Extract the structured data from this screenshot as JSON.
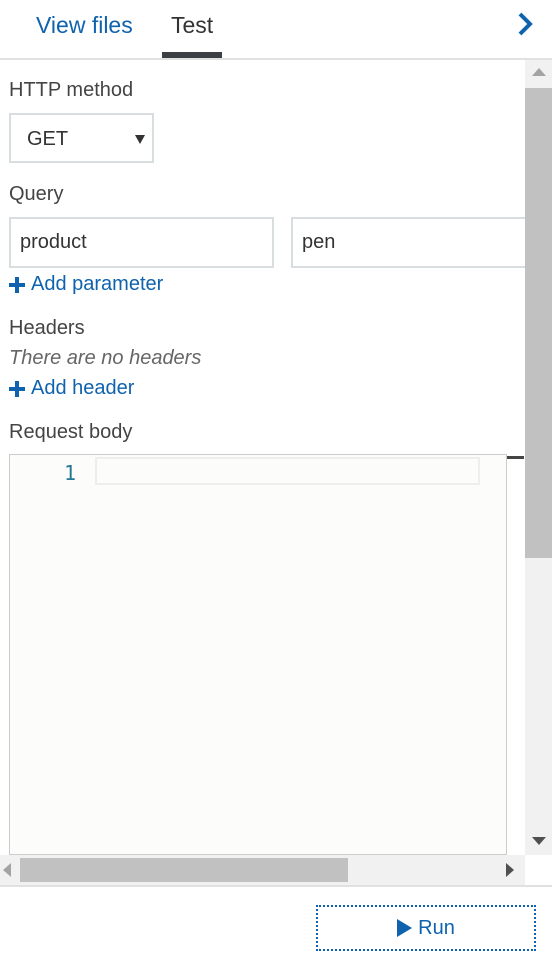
{
  "tabs": [
    {
      "label": "View files"
    },
    {
      "label": "Test"
    }
  ],
  "form": {
    "http_method_label": "HTTP method",
    "http_method_value": "GET",
    "query_label": "Query",
    "query_params": [
      {
        "name": "product",
        "value": "pen"
      }
    ],
    "add_parameter": "Add parameter",
    "headers_label": "Headers",
    "headers_empty": "There are no headers",
    "add_header": "Add header",
    "request_body_label": "Request body",
    "editor_line_number": "1"
  },
  "footer": {
    "run_label": "Run"
  },
  "colors": {
    "accent": "#0f62ae",
    "scrollbar_thumb": "#c1c1c1"
  },
  "icons": [
    "chevron-right-icon",
    "dropdown-caret-icon",
    "plus-icon",
    "play-icon"
  ]
}
